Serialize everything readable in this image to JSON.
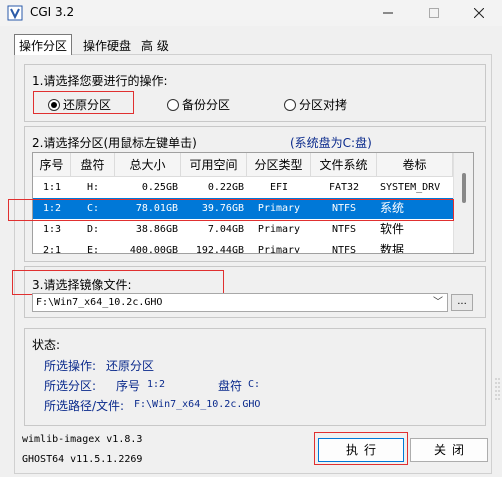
{
  "window": {
    "title": "CGI 3.2"
  },
  "tabs": [
    "操作分区",
    "操作硬盘",
    "高 级"
  ],
  "operation": {
    "label": "1.请选择您要进行的操作:",
    "options": [
      "还原分区",
      "备份分区",
      "分区对拷"
    ],
    "selected": "还原分区"
  },
  "partition": {
    "label": "2.请选择分区(用鼠标左键单击)",
    "system_note": "(系统盘为C:盘)",
    "columns": [
      "序号",
      "盘符",
      "总大小",
      "可用空间",
      "分区类型",
      "文件系统",
      "卷标"
    ],
    "rows": [
      [
        "1:1",
        "H:",
        "0.25GB",
        "0.22GB",
        "EFI",
        "FAT32",
        "SYSTEM_DRV"
      ],
      [
        "1:2",
        "C:",
        "78.01GB",
        "39.76GB",
        "Primary",
        "NTFS",
        "系统"
      ],
      [
        "1:3",
        "D:",
        "38.86GB",
        "7.04GB",
        "Primary",
        "NTFS",
        "软件"
      ],
      [
        "2:1",
        "E:",
        "400.00GB",
        "192.44GB",
        "Primary",
        "NTFS",
        "数据"
      ]
    ],
    "selected_row": 1
  },
  "image": {
    "label": "3.请选择镜像文件:",
    "path": "F:\\Win7_x64_10.2c.GHO",
    "browse_label": "..."
  },
  "status": {
    "title": "状态:",
    "op_label": "所选操作:",
    "op_value": "还原分区",
    "part_label": "所选分区:",
    "part_no_label": "序号",
    "part_no": "1:2",
    "drive_label": "盘符",
    "drive": "C:",
    "path_label": "所选路径/文件:",
    "path": "F:\\Win7_x64_10.2c.GHO"
  },
  "versions": [
    "wimlib-imagex v1.8.3",
    "GHOST64 v11.5.1.2269"
  ],
  "buttons": {
    "execute": "执行",
    "close": "关闭"
  },
  "colors": {
    "selection": "#0078d7",
    "highlight_box": "#e03030",
    "status_text": "#0a2a8c"
  }
}
